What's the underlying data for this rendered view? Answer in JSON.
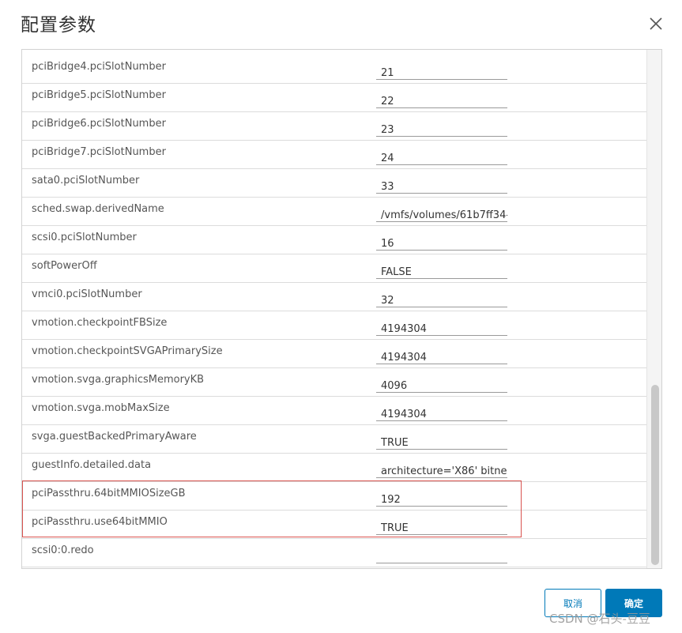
{
  "dialog": {
    "title": "配置参数",
    "cancel_label": "取消",
    "ok_label": "确定",
    "watermark": "CSDN @石头-豆豆"
  },
  "params": [
    {
      "name": "pciBridge4.pciSlotNumber",
      "value": "21"
    },
    {
      "name": "pciBridge5.pciSlotNumber",
      "value": "22"
    },
    {
      "name": "pciBridge6.pciSlotNumber",
      "value": "23"
    },
    {
      "name": "pciBridge7.pciSlotNumber",
      "value": "24"
    },
    {
      "name": "sata0.pciSlotNumber",
      "value": "33"
    },
    {
      "name": "sched.swap.derivedName",
      "value": "/vmfs/volumes/61b7ff34-"
    },
    {
      "name": "scsi0.pciSlotNumber",
      "value": "16"
    },
    {
      "name": "softPowerOff",
      "value": "FALSE"
    },
    {
      "name": "vmci0.pciSlotNumber",
      "value": "32"
    },
    {
      "name": "vmotion.checkpointFBSize",
      "value": "4194304"
    },
    {
      "name": "vmotion.checkpointSVGAPrimarySize",
      "value": "4194304"
    },
    {
      "name": "vmotion.svga.graphicsMemoryKB",
      "value": "4096"
    },
    {
      "name": "vmotion.svga.mobMaxSize",
      "value": "4194304"
    },
    {
      "name": "svga.guestBackedPrimaryAware",
      "value": "TRUE"
    },
    {
      "name": "guestInfo.detailed.data",
      "value": "architecture='X86' bitnes"
    },
    {
      "name": "pciPassthru.64bitMMIOSizeGB",
      "value": "192"
    },
    {
      "name": "pciPassthru.use64bitMMIO",
      "value": "TRUE"
    },
    {
      "name": "scsi0:0.redo",
      "value": ""
    }
  ],
  "colors": {
    "accent": "#0079b8",
    "highlight": "#d9534f"
  }
}
